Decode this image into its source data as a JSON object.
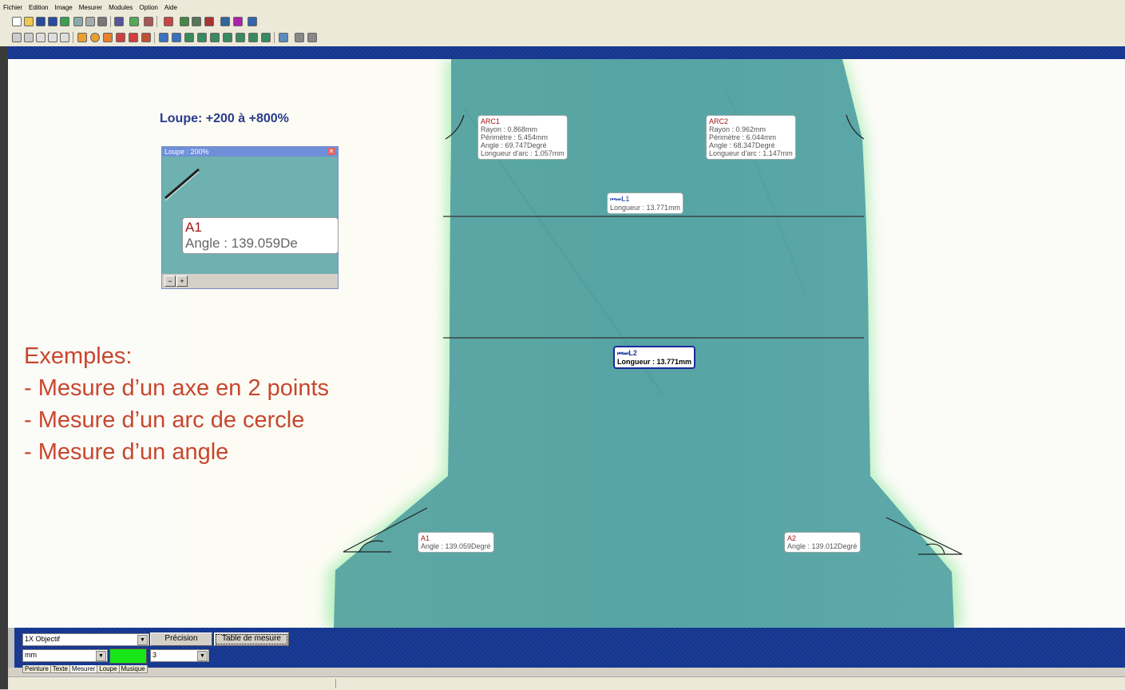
{
  "menu": [
    "Fichier",
    "Edition",
    "Image",
    "Mesurer",
    "Modules",
    "Option",
    "Aide"
  ],
  "annotations": {
    "arc1": {
      "name": "ARC1",
      "lines": [
        "Rayon : 0.868mm",
        "Périmètre : 5.454mm",
        "Angle : 69.747Degré",
        "Longueur d'arc : 1.057mm"
      ]
    },
    "arc2": {
      "name": "ARC2",
      "lines": [
        "Rayon : 0.962mm",
        "Périmètre : 6.044mm",
        "Angle : 68.347Degré",
        "Longueur d'arc : 1.147mm"
      ]
    },
    "l1": {
      "name": "L1",
      "line": "Longueur : 13.771mm"
    },
    "l2": {
      "name": "L2",
      "line": "Longueur : 13.771mm"
    },
    "a1": {
      "name": "A1",
      "line": "Angle : 139.059Degré"
    },
    "a2": {
      "name": "A2",
      "line": "Angle : 139.012Degré"
    }
  },
  "loupe_caption": "Loupe: +200 à +800%",
  "loupe_window": {
    "title": "Loupe : 200%",
    "label_name": "A1",
    "label_value": "Angle : 139.059De"
  },
  "examples": {
    "heading": "Exemples:",
    "items": [
      "- Mesure d’un axe en 2 points",
      "- Mesure d’un arc de cercle",
      "- Mesure d’un angle"
    ]
  },
  "bottom": {
    "objective": "1X Objectif",
    "precision_label": "Précision",
    "table_button": "Table de mesure",
    "unit": "mm",
    "decimals": "3",
    "color": "#19e619",
    "tabs": [
      "Peinture",
      "Texte",
      "Mesurer",
      "Loupe",
      "Musique"
    ]
  },
  "colors": {
    "accent_blue": "#14358f",
    "specimen": "#5aa6a6",
    "highlight_text": "#c8462e",
    "loupe_title": "#283a8c"
  }
}
